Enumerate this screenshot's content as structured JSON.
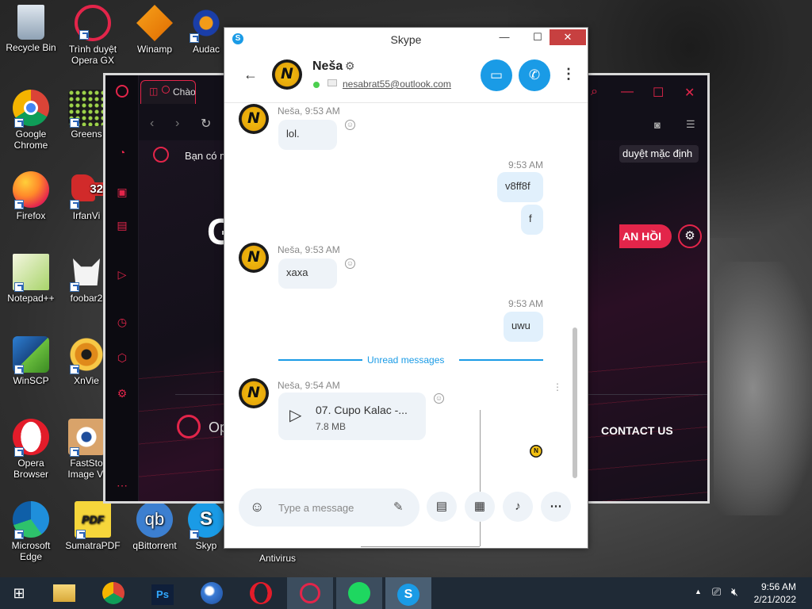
{
  "desktop": {
    "icons": [
      {
        "label": "Recycle Bin"
      },
      {
        "label": "Trình duyệt Opera GX"
      },
      {
        "label": "Winamp"
      },
      {
        "label": "Audac"
      },
      {
        "label": "Google Chrome"
      },
      {
        "label": "Greens"
      },
      {
        "label": "Firefox"
      },
      {
        "label": "IrfanVi"
      },
      {
        "label": "Notepad++"
      },
      {
        "label": "foobar2"
      },
      {
        "label": "WinSCP"
      },
      {
        "label": "XnVie"
      },
      {
        "label": "Opera Browser"
      },
      {
        "label": "FastSto Image Vi"
      },
      {
        "label": "Microsoft Edge"
      },
      {
        "label": "SumatraPDF"
      },
      {
        "label": "qBittorrent"
      },
      {
        "label": "Skyp"
      },
      {
        "label": "Antivirus"
      }
    ]
  },
  "opera_gx": {
    "tab_title": "Chào mừ",
    "banner_text": "Bạn có m",
    "default_pill": "duyệt mặc định",
    "hero_text": "GX",
    "red_button": "AN HỒI",
    "contact": "CONTACT US",
    "footer_brand": "Op"
  },
  "skype": {
    "window_title": "Skype",
    "contact_name": "Neša",
    "contact_email": "nesabrat55@outlook.com",
    "messages": [
      {
        "meta": "Neša, 9:53 AM",
        "text": "lol."
      },
      {
        "meta": "9:53 AM",
        "text": "v8ff8f"
      },
      {
        "text": "f"
      },
      {
        "meta": "Neša, 9:53 AM",
        "text": "xaxa"
      },
      {
        "meta": "9:53 AM",
        "text": "uwu"
      },
      {
        "meta": "Neša, 9:54 AM"
      }
    ],
    "unread_label": "Unread messages",
    "file": {
      "name": "07. Cupo Kalac -...",
      "size": "7.8 MB"
    },
    "composer_placeholder": "Type a message"
  },
  "taskbar": {
    "time": "9:56 AM",
    "date": "2/21/2022"
  }
}
